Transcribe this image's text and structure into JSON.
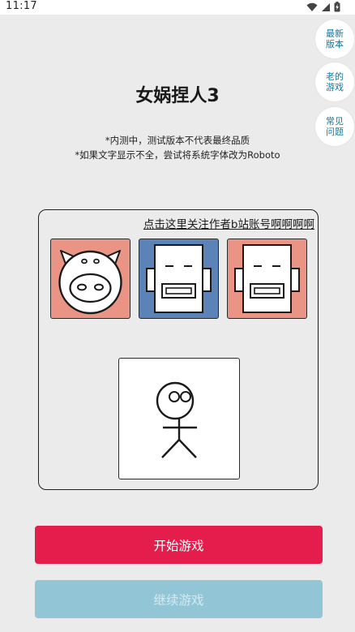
{
  "status_bar": {
    "time": "11:17",
    "icons": [
      "wifi-icon",
      "signal-icon",
      "battery-charging-icon"
    ]
  },
  "side_buttons": {
    "latest": "最新版本",
    "old": "老的游戏",
    "faq": "常见问题"
  },
  "title": "女娲捏人3",
  "notices": [
    "*内测中，测试版本不代表最终品质",
    "*如果文字显示不全，尝试将系统字体改为Roboto"
  ],
  "panel": {
    "follow_link": "点击这里关注作者b站账号啊啊啊啊",
    "cards": [
      {
        "icon": "pig-face-icon",
        "bg": "#ea9485"
      },
      {
        "icon": "robot-face-icon",
        "bg": "#5b83b8"
      },
      {
        "icon": "robot-face-icon",
        "bg": "#ea9485"
      }
    ],
    "character_icon": "stick-figure-icon"
  },
  "buttons": {
    "start": "开始游戏",
    "continue": "继续游戏"
  },
  "colors": {
    "start_button": "#e41d4c",
    "continue_button": "#92c6d6",
    "side_button_text": "#1478a0"
  }
}
